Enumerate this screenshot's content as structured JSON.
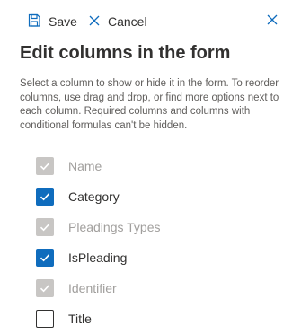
{
  "toolbar": {
    "save_label": "Save",
    "cancel_label": "Cancel"
  },
  "panel": {
    "title": "Edit columns in the form",
    "description": "Select a column to show or hide it in the form. To reorder columns, use drag and drop, or find more options next to each column. Required columns and columns with conditional formulas can't be hidden."
  },
  "columns": [
    {
      "label": "Name",
      "checked": true,
      "disabled": true
    },
    {
      "label": "Category",
      "checked": true,
      "disabled": false
    },
    {
      "label": "Pleadings Types",
      "checked": true,
      "disabled": true
    },
    {
      "label": "IsPleading",
      "checked": true,
      "disabled": false
    },
    {
      "label": "Identifier",
      "checked": true,
      "disabled": true
    },
    {
      "label": "Title",
      "checked": false,
      "disabled": false
    }
  ],
  "colors": {
    "accent": "#0f6cbd",
    "disabled": "#c8c6c4"
  },
  "icons": {
    "save": "save-icon",
    "cancel": "cancel-x-icon",
    "close": "close-icon",
    "check": "checkmark-icon"
  }
}
